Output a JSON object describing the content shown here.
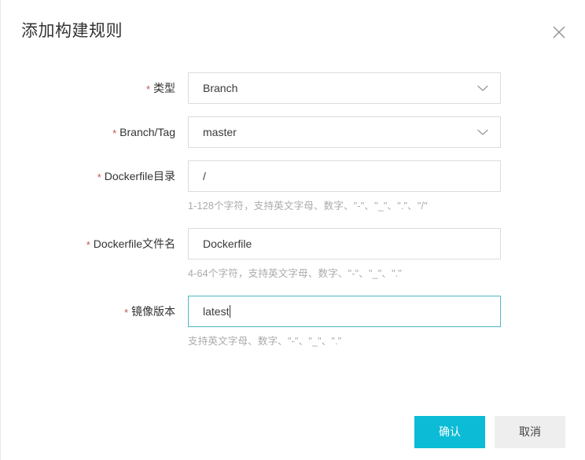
{
  "dialog": {
    "title": "添加构建规则",
    "close_icon": "close-icon"
  },
  "form": {
    "required_marker": "*",
    "fields": [
      {
        "label": "类型",
        "type": "select",
        "value": "Branch",
        "icon": "chevron-down-icon",
        "hint": "",
        "focused": false
      },
      {
        "label": "Branch/Tag",
        "type": "select",
        "value": "master",
        "icon": "chevron-down-icon",
        "hint": "",
        "focused": false
      },
      {
        "label": "Dockerfile目录",
        "type": "text",
        "value": "/",
        "hint": "1-128个字符，支持英文字母、数字、\"-\"、\"_\"、\".\"、\"/\"",
        "focused": false
      },
      {
        "label": "Dockerfile文件名",
        "type": "text",
        "value": "Dockerfile",
        "hint": "4-64个字符，支持英文字母、数字、\"-\"、\"_\"、\".\"",
        "focused": false
      },
      {
        "label": "镜像版本",
        "type": "text",
        "value": "latest",
        "hint": "支持英文字母、数字、\"-\"、\"_\"、\".\"",
        "focused": true
      }
    ]
  },
  "footer": {
    "confirm_label": "确认",
    "cancel_label": "取消"
  },
  "colors": {
    "primary": "#0cbcd6",
    "focus_border": "#4db8c4",
    "required_star": "#c45656",
    "hint_text": "#aaaaaa",
    "input_border": "#dcdcdc",
    "cancel_bg": "#eeeeee"
  }
}
